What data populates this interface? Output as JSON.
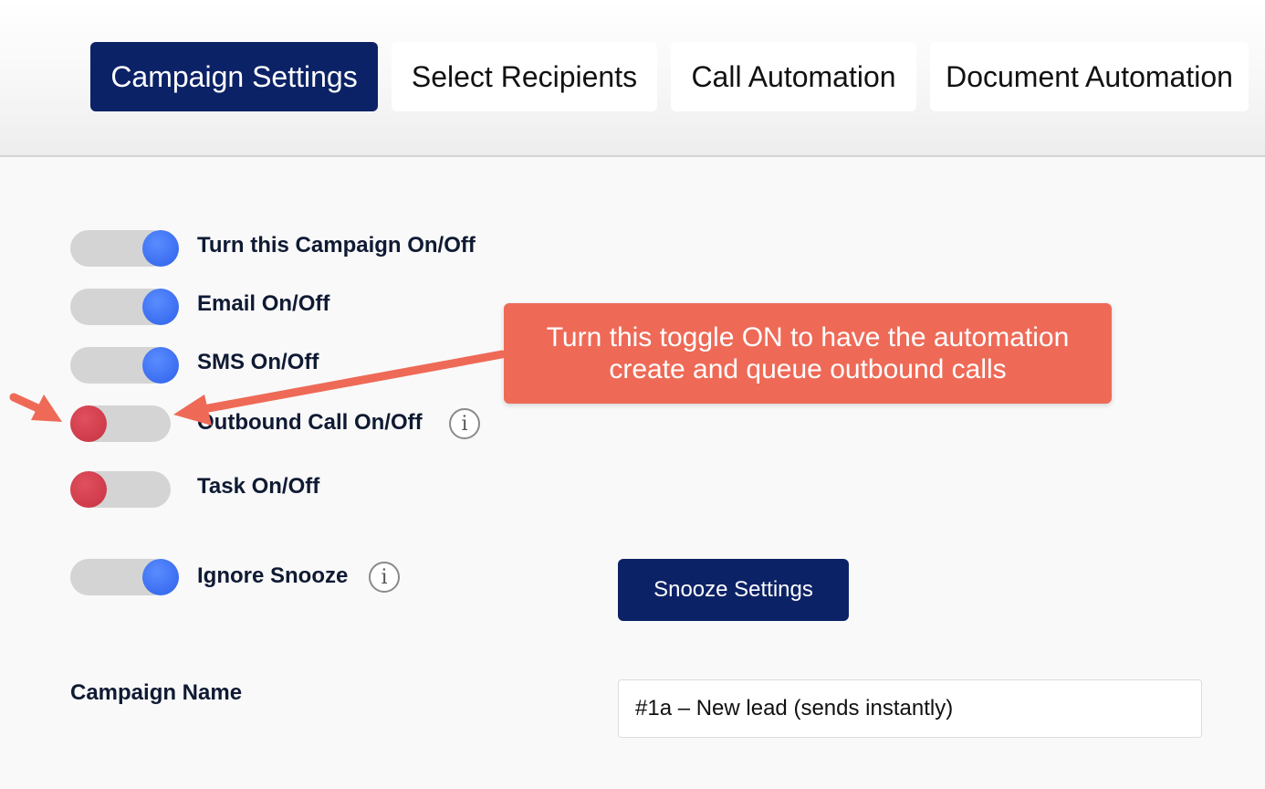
{
  "tabs": [
    {
      "label": "Campaign Settings",
      "active": true
    },
    {
      "label": "Select Recipients",
      "active": false
    },
    {
      "label": "Call Automation",
      "active": false
    },
    {
      "label": "Document Automation",
      "active": false
    }
  ],
  "toggles": [
    {
      "label": "Turn this Campaign On/Off",
      "state": "on"
    },
    {
      "label": "Email On/Off",
      "state": "on"
    },
    {
      "label": "SMS On/Off",
      "state": "on"
    },
    {
      "label": "Outbound Call On/Off",
      "state": "off",
      "has_info_icon": true
    },
    {
      "label": "Task On/Off",
      "state": "off"
    },
    {
      "label": "Ignore Snooze",
      "state": "on",
      "has_info_icon": true
    }
  ],
  "snooze_button": {
    "label": "Snooze Settings"
  },
  "campaign_name": {
    "label": "Campaign Name",
    "value": "#1a – New lead (sends instantly)"
  },
  "info_icon_glyph": "i",
  "annotation": {
    "line1": "Turn this toggle ON to have the automation",
    "line2": "create and queue outbound calls"
  },
  "colors": {
    "accent": "#0c2266",
    "toggle_on": "#3b6ef0",
    "toggle_off": "#cf3b4a",
    "callout": "#ee6a57"
  }
}
